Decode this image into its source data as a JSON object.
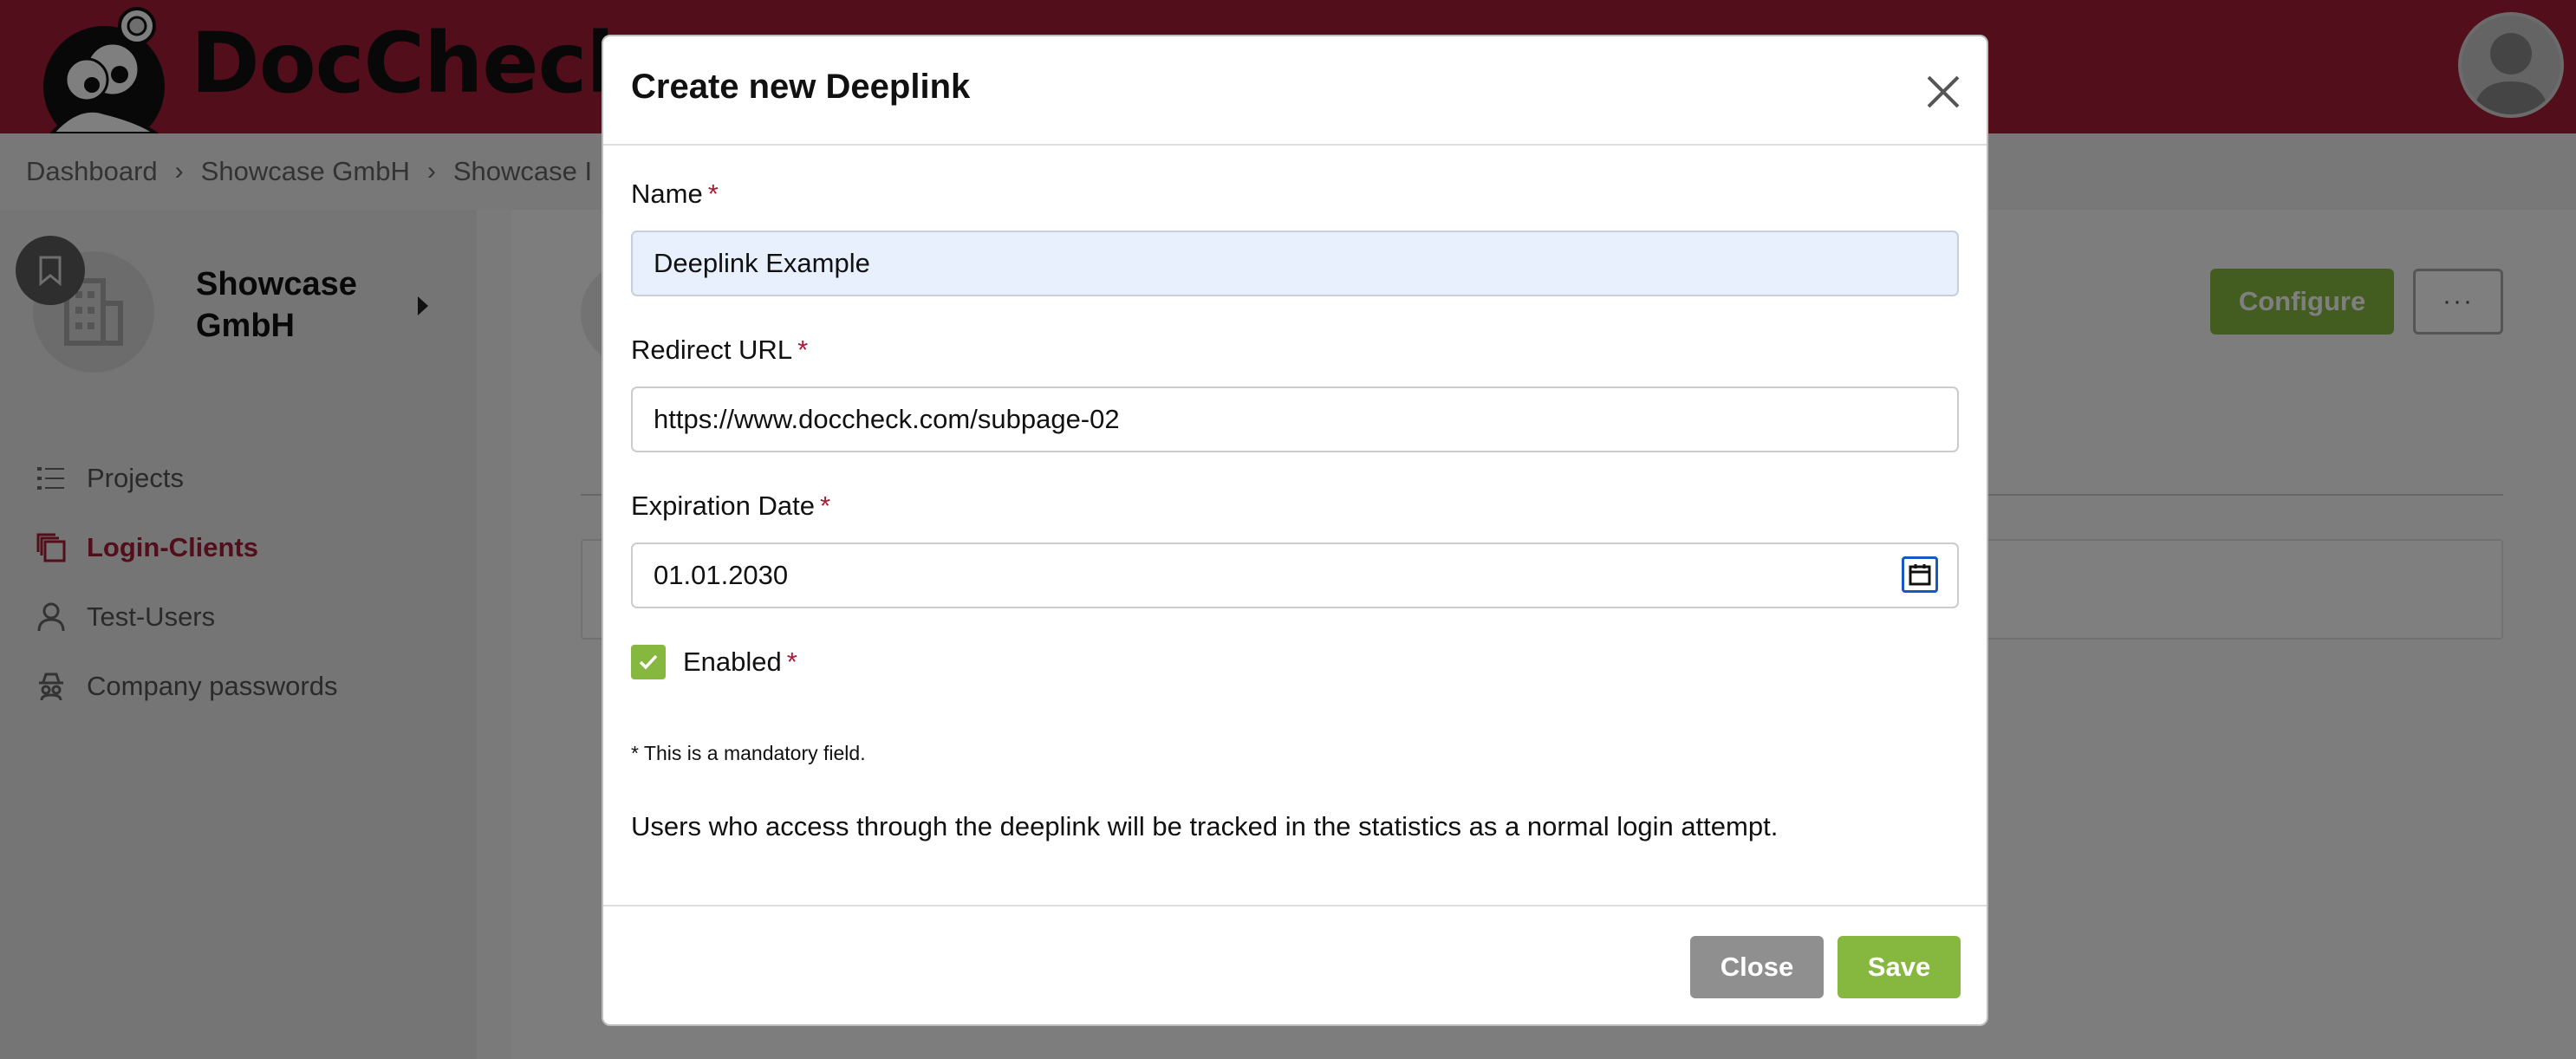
{
  "header": {
    "brand_name": "DocCheck",
    "colors": {
      "brand_red": "#a51d36",
      "accent_green": "#86b83f"
    }
  },
  "breadcrumb": {
    "items": [
      "Dashboard",
      "Showcase GmbH",
      "Showcase I"
    ],
    "separator": "›"
  },
  "sidebar": {
    "company_name": "Showcase GmbH",
    "nav": [
      {
        "label": "Projects",
        "icon": "list-icon"
      },
      {
        "label": "Login-Clients",
        "icon": "copy-icon",
        "active": true
      },
      {
        "label": "Test-Users",
        "icon": "user-icon"
      },
      {
        "label": "Company passwords",
        "icon": "spy-icon"
      }
    ]
  },
  "main": {
    "configure_label": "Configure",
    "more_label": "···"
  },
  "modal": {
    "title": "Create new Deeplink",
    "name_label": "Name",
    "name_value": "Deeplink Example",
    "redirect_label": "Redirect URL",
    "redirect_value": "https://www.doccheck.com/subpage-02",
    "expiration_label": "Expiration Date",
    "expiration_value": "01.01.2030",
    "enabled_label": "Enabled",
    "enabled_checked": true,
    "required_marker": "*",
    "mandatory_note": "* This is a mandatory field.",
    "info_text": "Users who access through the deeplink will be tracked in the statistics as a normal login attempt.",
    "close_label": "Close",
    "save_label": "Save"
  }
}
